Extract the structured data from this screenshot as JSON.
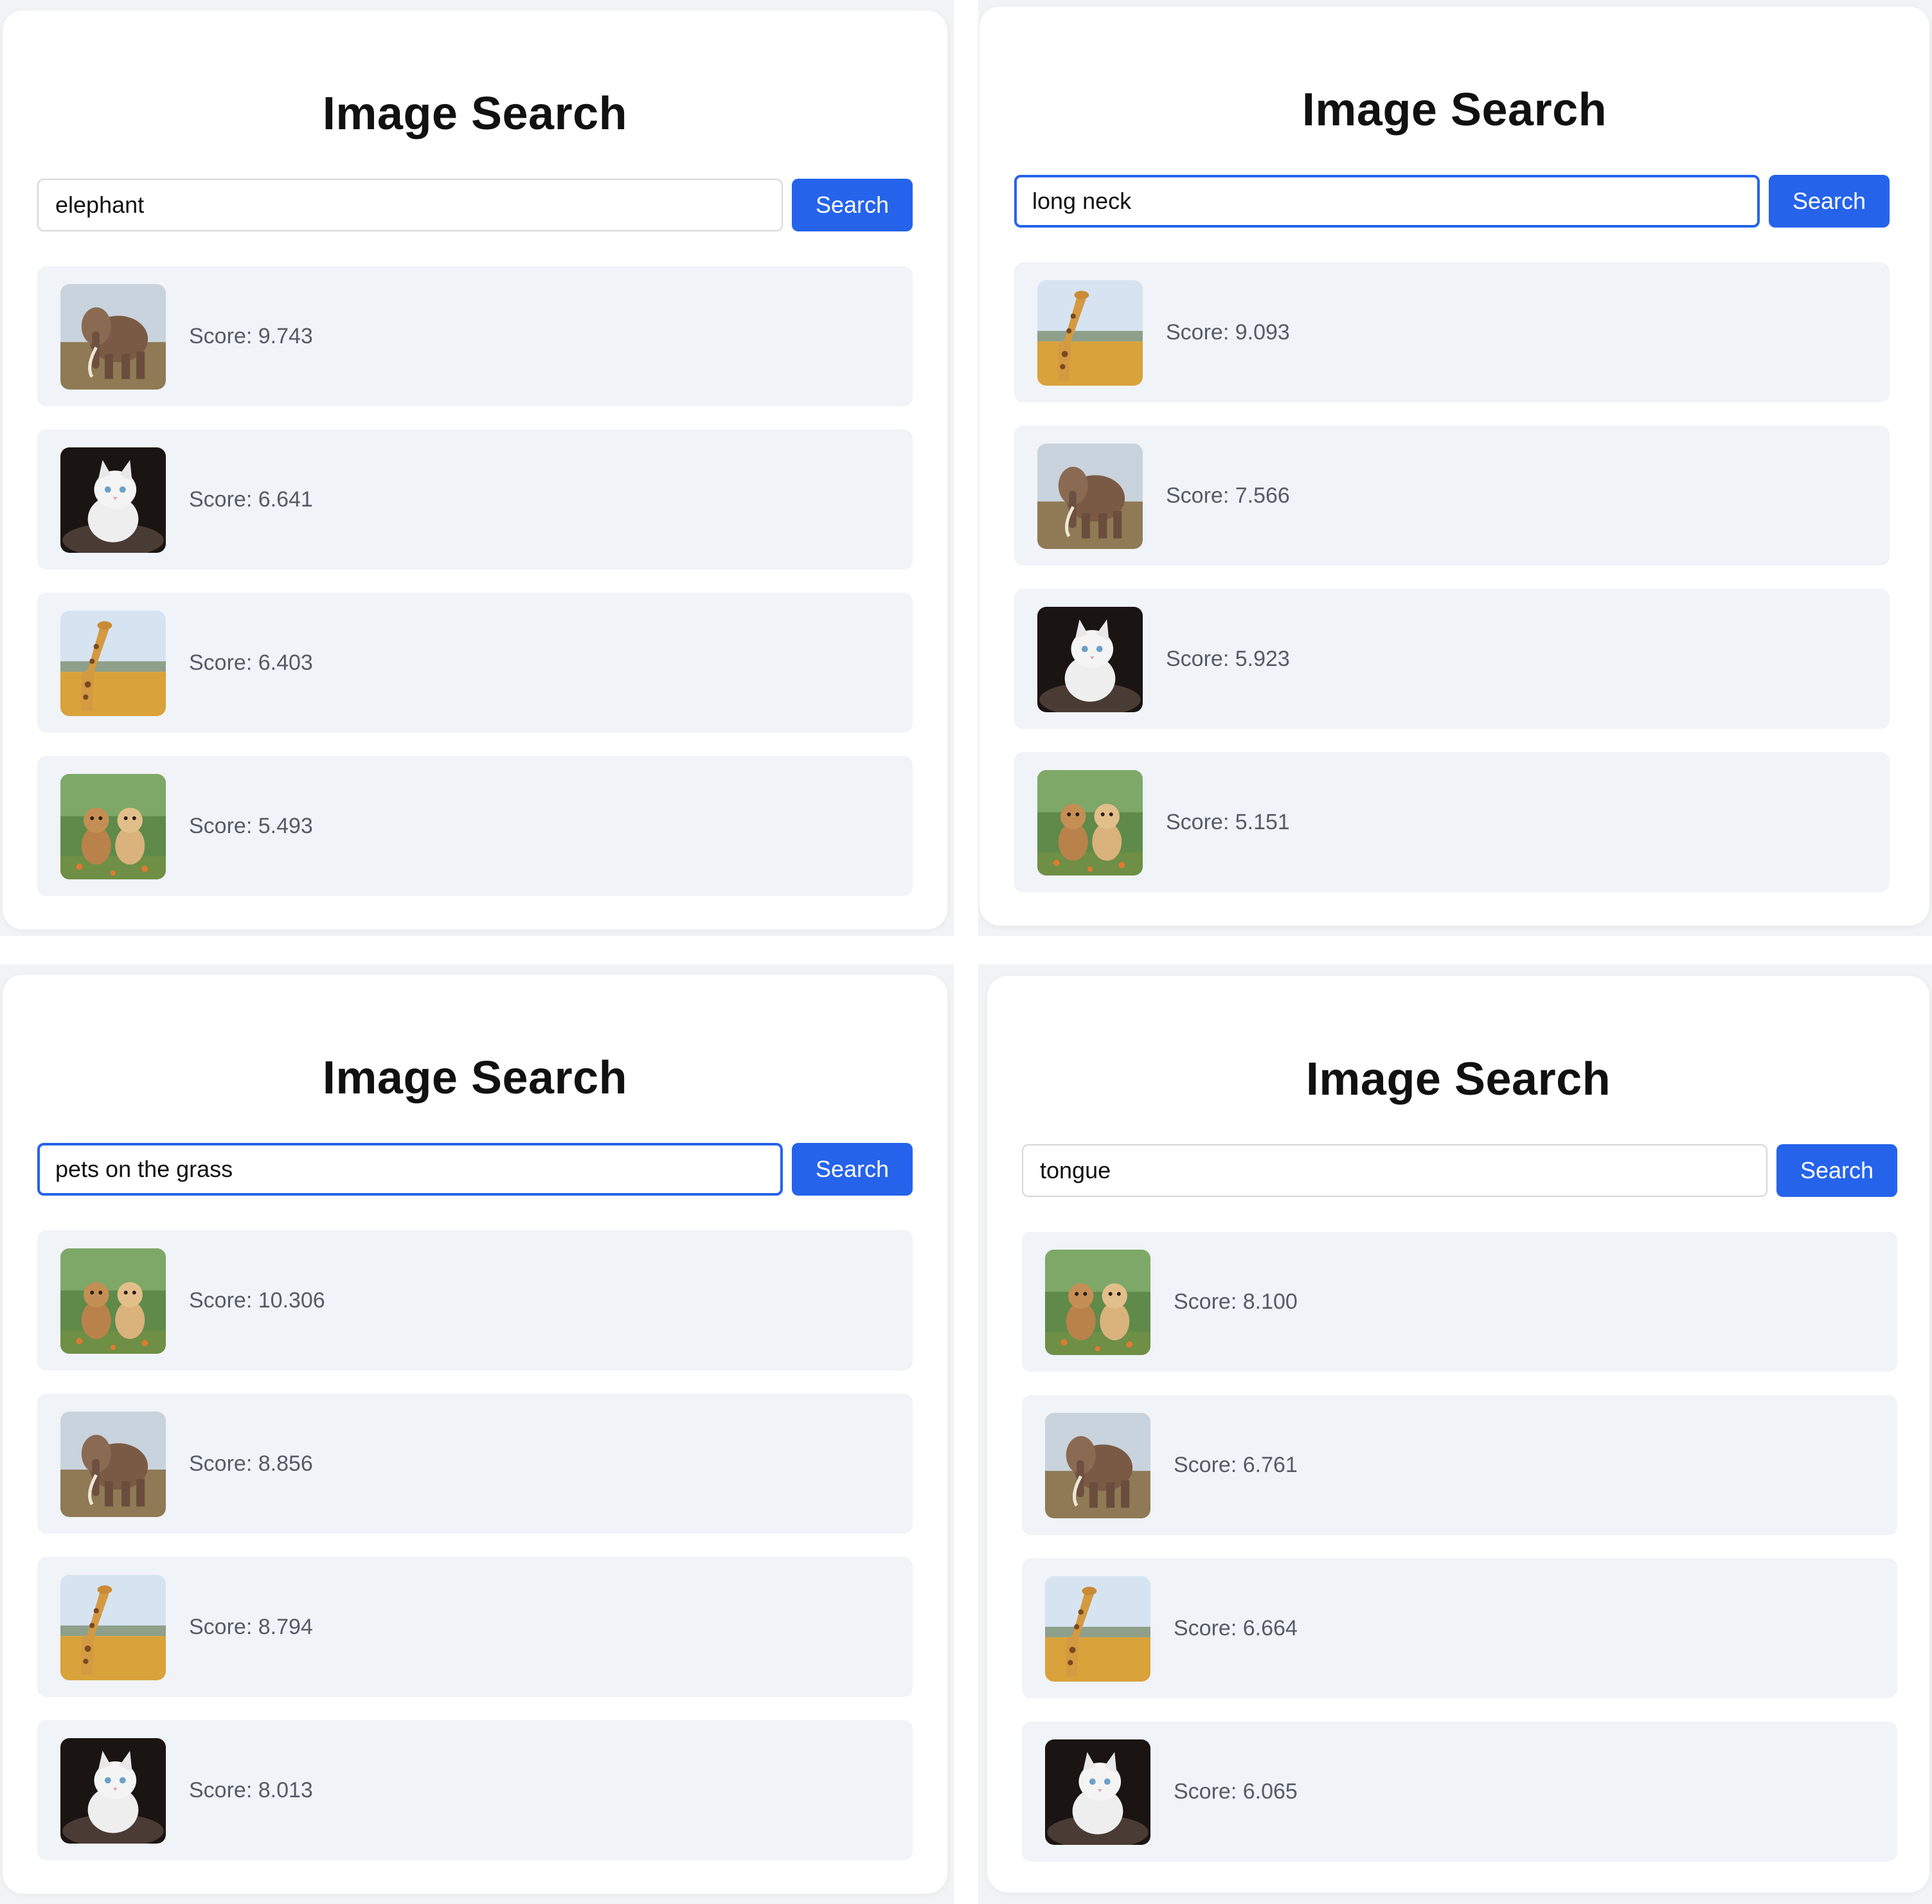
{
  "panels": [
    {
      "title": "Image Search",
      "query": "elephant",
      "button_label": "Search",
      "focused": false,
      "results": [
        {
          "image": "elephant",
          "score_label": "Score: 9.743"
        },
        {
          "image": "kitten",
          "score_label": "Score: 6.641"
        },
        {
          "image": "giraffe",
          "score_label": "Score: 6.403"
        },
        {
          "image": "puppies",
          "score_label": "Score: 5.493"
        }
      ]
    },
    {
      "title": "Image Search",
      "query": "long neck",
      "button_label": "Search",
      "focused": true,
      "results": [
        {
          "image": "giraffe",
          "score_label": "Score: 9.093"
        },
        {
          "image": "elephant",
          "score_label": "Score: 7.566"
        },
        {
          "image": "kitten",
          "score_label": "Score: 5.923"
        },
        {
          "image": "puppies",
          "score_label": "Score: 5.151"
        }
      ]
    },
    {
      "title": "Image Search",
      "query": "pets on the grass",
      "button_label": "Search",
      "focused": true,
      "results": [
        {
          "image": "puppies",
          "score_label": "Score: 10.306"
        },
        {
          "image": "elephant",
          "score_label": "Score: 8.856"
        },
        {
          "image": "giraffe",
          "score_label": "Score: 8.794"
        },
        {
          "image": "kitten",
          "score_label": "Score: 8.013"
        }
      ]
    },
    {
      "title": "Image Search",
      "query": "tongue",
      "button_label": "Search",
      "focused": false,
      "results": [
        {
          "image": "puppies",
          "score_label": "Score: 8.100"
        },
        {
          "image": "elephant",
          "score_label": "Score: 6.761"
        },
        {
          "image": "giraffe",
          "score_label": "Score: 6.664"
        },
        {
          "image": "kitten",
          "score_label": "Score: 6.065"
        }
      ]
    }
  ],
  "colors": {
    "accent": "#2563eb",
    "result_background": "#f0f3f8",
    "score_text": "#555b66"
  }
}
